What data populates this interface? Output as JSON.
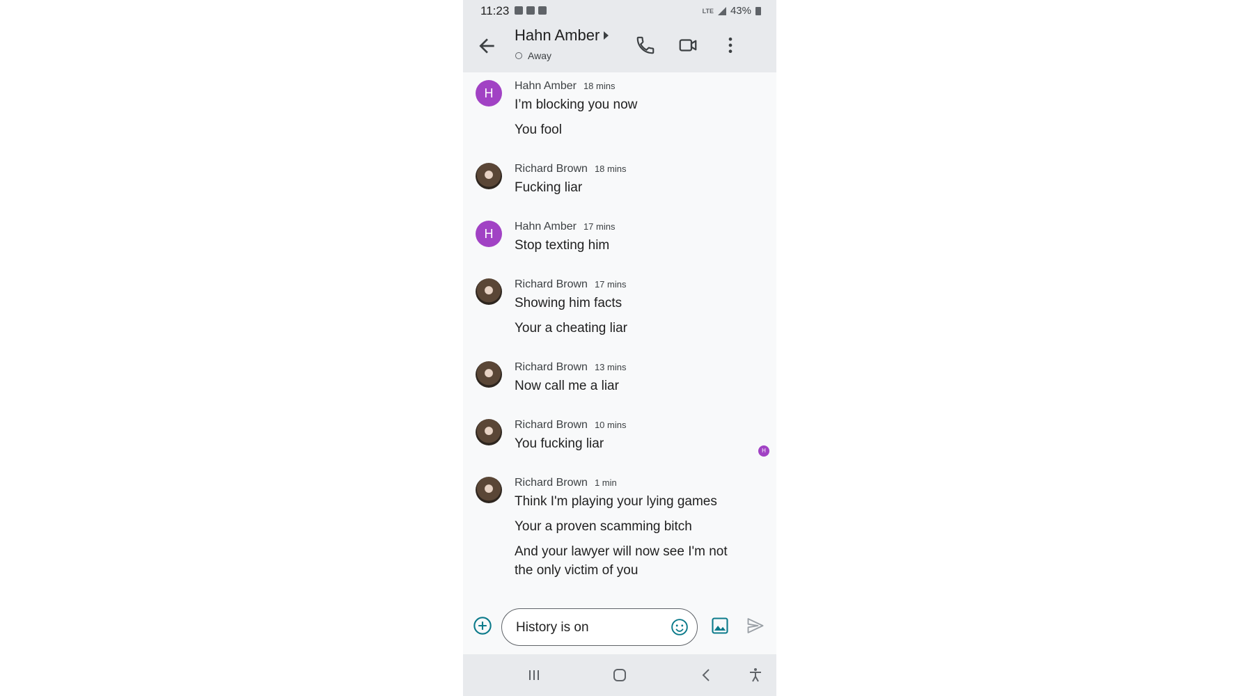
{
  "status_bar": {
    "time": "11:23",
    "network": "LTE",
    "battery": "43%"
  },
  "header": {
    "contact_name": "Hahn Amber",
    "presence": "Away"
  },
  "messages": [
    {
      "sender": "Hahn Amber",
      "avatar": "H",
      "time": "18 mins",
      "lines": [
        "I’m blocking you now",
        "You fool"
      ]
    },
    {
      "sender": "Richard Brown",
      "time": "18 mins",
      "lines": [
        "Fucking liar"
      ]
    },
    {
      "sender": "Hahn Amber",
      "avatar": "H",
      "time": "17 mins",
      "lines": [
        "Stop texting him"
      ]
    },
    {
      "sender": "Richard Brown",
      "time": "17 mins",
      "lines": [
        "Showing him facts",
        "Your a cheating liar"
      ]
    },
    {
      "sender": "Richard Brown",
      "time": "13 mins",
      "lines": [
        "Now call me a liar"
      ]
    },
    {
      "sender": "Richard Brown",
      "time": "10 mins",
      "lines": [
        "You fucking liar"
      ]
    },
    {
      "sender": "Richard Brown",
      "time": "1 min",
      "lines": [
        "Think I'm playing your lying games",
        "Your a proven scamming bitch",
        "And your lawyer  will now see I'm not the only victim of you"
      ]
    }
  ],
  "read_receipt": "H",
  "compose": {
    "value": "History is on"
  },
  "colors": {
    "accent": "#a142c4",
    "icon_teal": "#1a73e8"
  }
}
